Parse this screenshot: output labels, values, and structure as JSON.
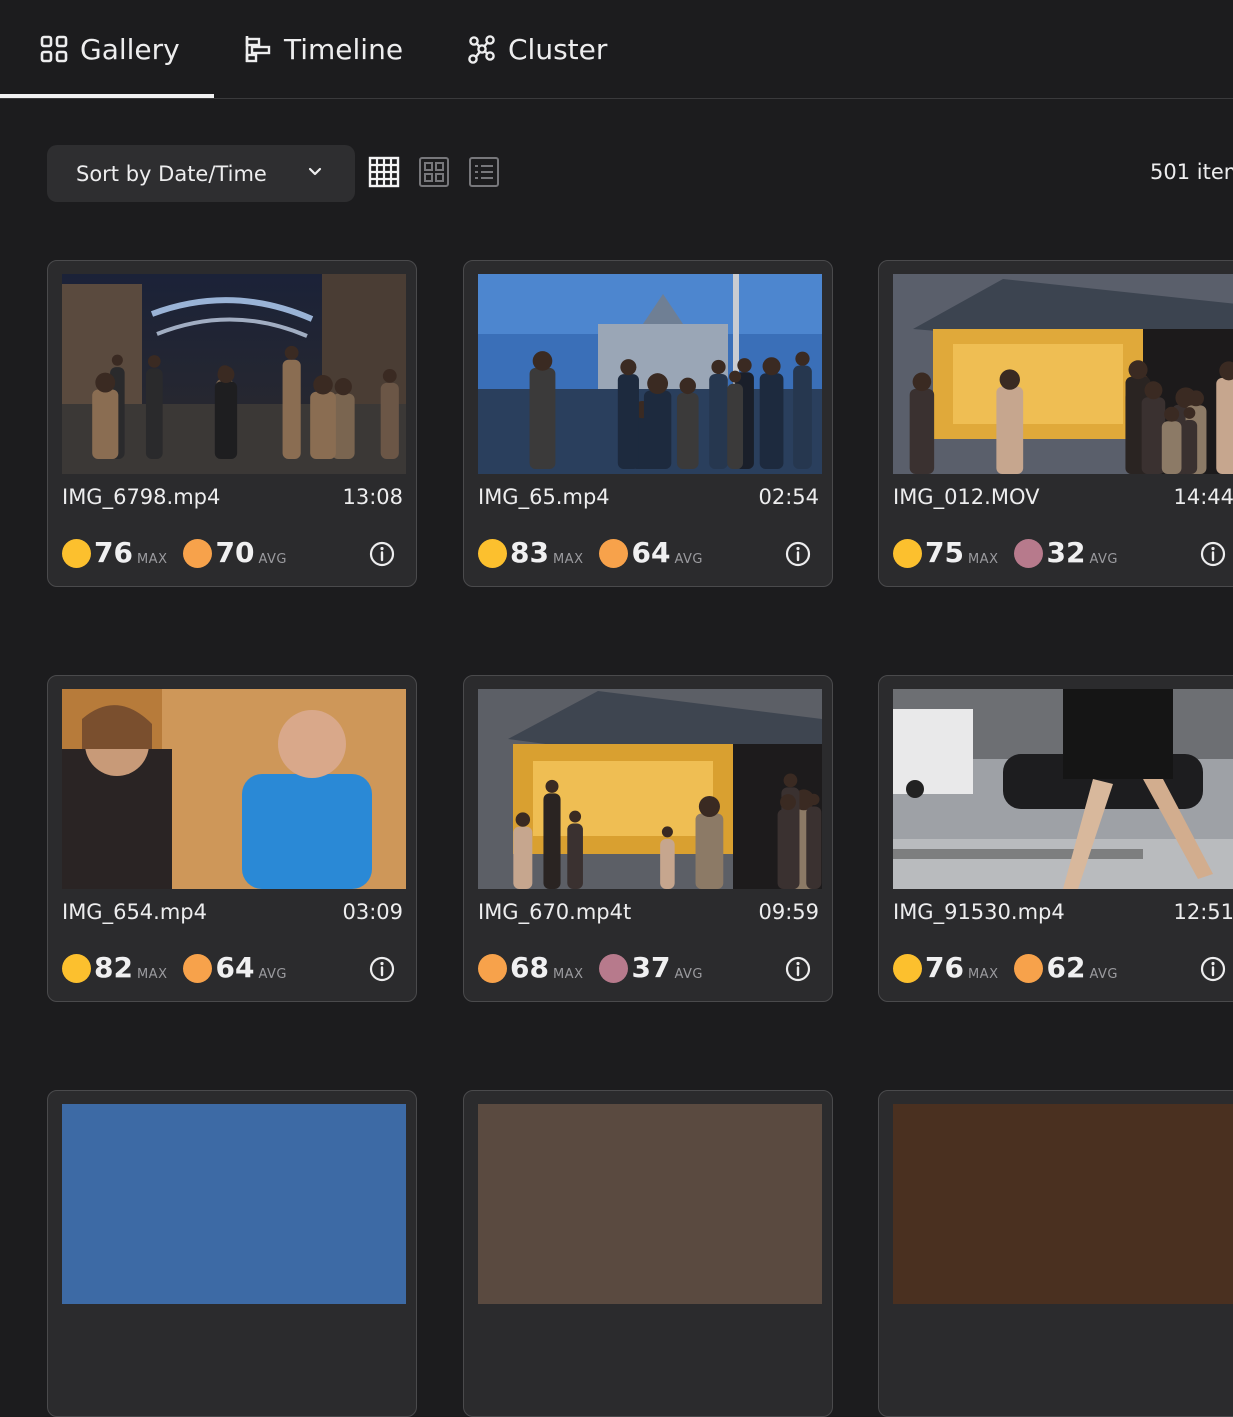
{
  "tabs": [
    {
      "label": "Gallery",
      "icon": "grid-icon",
      "active": true
    },
    {
      "label": "Timeline",
      "icon": "timeline-icon",
      "active": false
    },
    {
      "label": "Cluster",
      "icon": "cluster-icon",
      "active": false
    }
  ],
  "toolbar": {
    "sort_label": "Sort by Date/Time",
    "views": [
      "dense-grid-view",
      "grid-view",
      "list-view"
    ],
    "active_view": "dense-grid-view",
    "item_count": "501 item"
  },
  "stats_units": {
    "max": "MAX",
    "avg": "AVG"
  },
  "colors": {
    "yellow": "#fcc02e",
    "orange": "#f7a24b",
    "mauve": "#b77a8c",
    "background": "#1c1c1e",
    "card": "#2b2b2d"
  },
  "cards": [
    {
      "filename": "IMG_6798.mp4",
      "duration": "13:08",
      "max": "76",
      "max_color": "yellow",
      "avg": "70",
      "avg_color": "orange"
    },
    {
      "filename": "IMG_65.mp4",
      "duration": "02:54",
      "max": "83",
      "max_color": "yellow",
      "avg": "64",
      "avg_color": "orange"
    },
    {
      "filename": "IMG_012.MOV",
      "duration": "14:44",
      "max": "75",
      "max_color": "yellow",
      "avg": "32",
      "avg_color": "mauve"
    },
    {
      "filename": "IMG_654.mp4",
      "duration": "03:09",
      "max": "82",
      "max_color": "yellow",
      "avg": "64",
      "avg_color": "orange"
    },
    {
      "filename": "IMG_670.mp4t",
      "duration": "09:59",
      "max": "68",
      "max_color": "orange",
      "avg": "37",
      "avg_color": "mauve"
    },
    {
      "filename": "IMG_91530.mp4",
      "duration": "12:51",
      "max": "76",
      "max_color": "yellow",
      "avg": "62",
      "avg_color": "orange"
    }
  ]
}
